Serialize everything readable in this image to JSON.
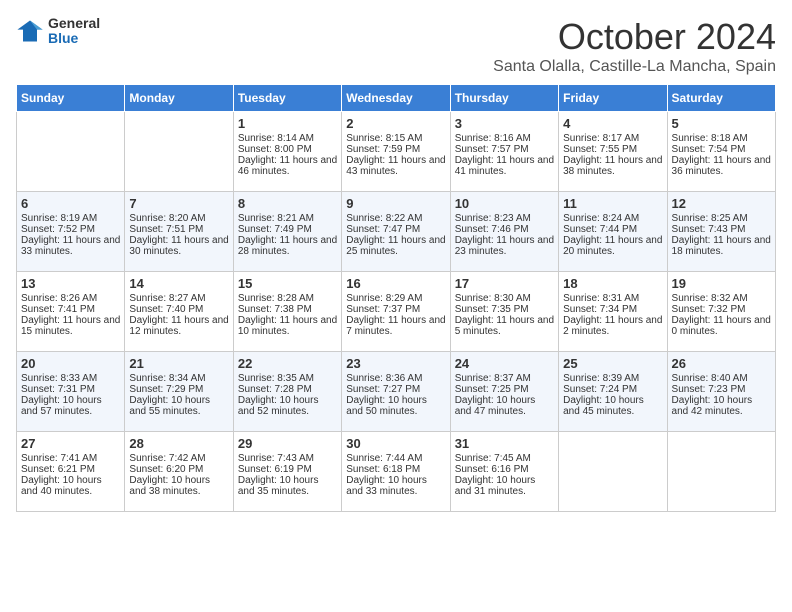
{
  "header": {
    "logo_general": "General",
    "logo_blue": "Blue",
    "month_year": "October 2024",
    "location": "Santa Olalla, Castille-La Mancha, Spain"
  },
  "days_of_week": [
    "Sunday",
    "Monday",
    "Tuesday",
    "Wednesday",
    "Thursday",
    "Friday",
    "Saturday"
  ],
  "weeks": [
    [
      {
        "day": "",
        "info": ""
      },
      {
        "day": "",
        "info": ""
      },
      {
        "day": "1",
        "info": "Sunrise: 8:14 AM\nSunset: 8:00 PM\nDaylight: 11 hours and 46 minutes."
      },
      {
        "day": "2",
        "info": "Sunrise: 8:15 AM\nSunset: 7:59 PM\nDaylight: 11 hours and 43 minutes."
      },
      {
        "day": "3",
        "info": "Sunrise: 8:16 AM\nSunset: 7:57 PM\nDaylight: 11 hours and 41 minutes."
      },
      {
        "day": "4",
        "info": "Sunrise: 8:17 AM\nSunset: 7:55 PM\nDaylight: 11 hours and 38 minutes."
      },
      {
        "day": "5",
        "info": "Sunrise: 8:18 AM\nSunset: 7:54 PM\nDaylight: 11 hours and 36 minutes."
      }
    ],
    [
      {
        "day": "6",
        "info": "Sunrise: 8:19 AM\nSunset: 7:52 PM\nDaylight: 11 hours and 33 minutes."
      },
      {
        "day": "7",
        "info": "Sunrise: 8:20 AM\nSunset: 7:51 PM\nDaylight: 11 hours and 30 minutes."
      },
      {
        "day": "8",
        "info": "Sunrise: 8:21 AM\nSunset: 7:49 PM\nDaylight: 11 hours and 28 minutes."
      },
      {
        "day": "9",
        "info": "Sunrise: 8:22 AM\nSunset: 7:47 PM\nDaylight: 11 hours and 25 minutes."
      },
      {
        "day": "10",
        "info": "Sunrise: 8:23 AM\nSunset: 7:46 PM\nDaylight: 11 hours and 23 minutes."
      },
      {
        "day": "11",
        "info": "Sunrise: 8:24 AM\nSunset: 7:44 PM\nDaylight: 11 hours and 20 minutes."
      },
      {
        "day": "12",
        "info": "Sunrise: 8:25 AM\nSunset: 7:43 PM\nDaylight: 11 hours and 18 minutes."
      }
    ],
    [
      {
        "day": "13",
        "info": "Sunrise: 8:26 AM\nSunset: 7:41 PM\nDaylight: 11 hours and 15 minutes."
      },
      {
        "day": "14",
        "info": "Sunrise: 8:27 AM\nSunset: 7:40 PM\nDaylight: 11 hours and 12 minutes."
      },
      {
        "day": "15",
        "info": "Sunrise: 8:28 AM\nSunset: 7:38 PM\nDaylight: 11 hours and 10 minutes."
      },
      {
        "day": "16",
        "info": "Sunrise: 8:29 AM\nSunset: 7:37 PM\nDaylight: 11 hours and 7 minutes."
      },
      {
        "day": "17",
        "info": "Sunrise: 8:30 AM\nSunset: 7:35 PM\nDaylight: 11 hours and 5 minutes."
      },
      {
        "day": "18",
        "info": "Sunrise: 8:31 AM\nSunset: 7:34 PM\nDaylight: 11 hours and 2 minutes."
      },
      {
        "day": "19",
        "info": "Sunrise: 8:32 AM\nSunset: 7:32 PM\nDaylight: 11 hours and 0 minutes."
      }
    ],
    [
      {
        "day": "20",
        "info": "Sunrise: 8:33 AM\nSunset: 7:31 PM\nDaylight: 10 hours and 57 minutes."
      },
      {
        "day": "21",
        "info": "Sunrise: 8:34 AM\nSunset: 7:29 PM\nDaylight: 10 hours and 55 minutes."
      },
      {
        "day": "22",
        "info": "Sunrise: 8:35 AM\nSunset: 7:28 PM\nDaylight: 10 hours and 52 minutes."
      },
      {
        "day": "23",
        "info": "Sunrise: 8:36 AM\nSunset: 7:27 PM\nDaylight: 10 hours and 50 minutes."
      },
      {
        "day": "24",
        "info": "Sunrise: 8:37 AM\nSunset: 7:25 PM\nDaylight: 10 hours and 47 minutes."
      },
      {
        "day": "25",
        "info": "Sunrise: 8:39 AM\nSunset: 7:24 PM\nDaylight: 10 hours and 45 minutes."
      },
      {
        "day": "26",
        "info": "Sunrise: 8:40 AM\nSunset: 7:23 PM\nDaylight: 10 hours and 42 minutes."
      }
    ],
    [
      {
        "day": "27",
        "info": "Sunrise: 7:41 AM\nSunset: 6:21 PM\nDaylight: 10 hours and 40 minutes."
      },
      {
        "day": "28",
        "info": "Sunrise: 7:42 AM\nSunset: 6:20 PM\nDaylight: 10 hours and 38 minutes."
      },
      {
        "day": "29",
        "info": "Sunrise: 7:43 AM\nSunset: 6:19 PM\nDaylight: 10 hours and 35 minutes."
      },
      {
        "day": "30",
        "info": "Sunrise: 7:44 AM\nSunset: 6:18 PM\nDaylight: 10 hours and 33 minutes."
      },
      {
        "day": "31",
        "info": "Sunrise: 7:45 AM\nSunset: 6:16 PM\nDaylight: 10 hours and 31 minutes."
      },
      {
        "day": "",
        "info": ""
      },
      {
        "day": "",
        "info": ""
      }
    ]
  ]
}
